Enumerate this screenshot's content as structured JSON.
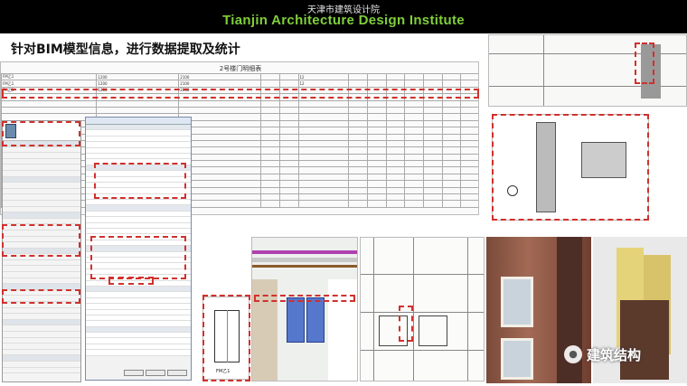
{
  "header": {
    "institute_cn": "天津市建筑设计院",
    "institute_en": "Tianjin Architecture Design Institute"
  },
  "slide": {
    "title": "针对BIM模型信息，进行数据提取及统计"
  },
  "schedule": {
    "title": "2号楼门明细表",
    "rows": [
      [
        "FM乙1",
        "1200",
        "2100",
        "",
        "",
        "12",
        "",
        "",
        "",
        "",
        "",
        "",
        ""
      ],
      [
        "FM乙1",
        "1200",
        "2100",
        "",
        "",
        "12",
        "",
        "",
        "",
        "",
        "",
        "",
        ""
      ],
      [
        "FM乙1",
        "1200",
        "2000",
        "",
        "",
        "",
        "",
        "",
        "",
        "",
        "",
        "",
        ""
      ],
      [
        "",
        "",
        "",
        "",
        "",
        "",
        "",
        "",
        "",
        "",
        "",
        "",
        ""
      ],
      [
        "",
        "",
        "",
        "",
        "",
        "",
        "",
        "",
        "",
        "",
        "",
        "",
        ""
      ],
      [
        "",
        "",
        "",
        "",
        "",
        "",
        "",
        "",
        "",
        "",
        "",
        "",
        ""
      ],
      [
        "",
        "",
        "",
        "",
        "",
        "",
        "",
        "",
        "",
        "",
        "",
        "",
        ""
      ],
      [
        "",
        "",
        "",
        "",
        "",
        "",
        "",
        "",
        "",
        "",
        "",
        "",
        ""
      ],
      [
        "",
        "",
        "",
        "",
        "",
        "",
        "",
        "",
        "",
        "",
        "",
        "",
        ""
      ],
      [
        "",
        "",
        "",
        "",
        "",
        "",
        "",
        "",
        "",
        "",
        "",
        "",
        ""
      ],
      [
        "",
        "",
        "",
        "",
        "",
        "",
        "",
        "",
        "",
        "",
        "",
        "",
        ""
      ],
      [
        "",
        "",
        "",
        "",
        "",
        "",
        "",
        "",
        "",
        "",
        "",
        "",
        ""
      ],
      [
        "",
        "",
        "",
        "",
        "",
        "",
        "",
        "",
        "",
        "",
        "",
        "",
        ""
      ],
      [
        "",
        "",
        "",
        "",
        "",
        "",
        "",
        "",
        "",
        "",
        "",
        "",
        ""
      ],
      [
        "",
        "",
        "",
        "",
        "",
        "",
        "",
        "",
        "",
        "",
        "",
        "",
        ""
      ],
      [
        "",
        "",
        "",
        "",
        "",
        "",
        "",
        "",
        "",
        "",
        "",
        "",
        ""
      ],
      [
        "",
        "",
        "",
        "",
        "",
        "",
        "",
        "",
        "",
        "",
        "",
        "",
        ""
      ],
      [
        "",
        "",
        "",
        "",
        "",
        "",
        "",
        "",
        "",
        "",
        "",
        "",
        ""
      ],
      [
        "",
        "",
        "",
        "",
        "",
        "",
        "",
        "",
        "",
        "",
        "",
        "",
        ""
      ],
      [
        "",
        "",
        "",
        "",
        "",
        "",
        "",
        "",
        "",
        "",
        "",
        "",
        ""
      ]
    ]
  },
  "drawing": {
    "door_tag": "FM乙1"
  },
  "watermark": {
    "text": "建筑结构"
  }
}
